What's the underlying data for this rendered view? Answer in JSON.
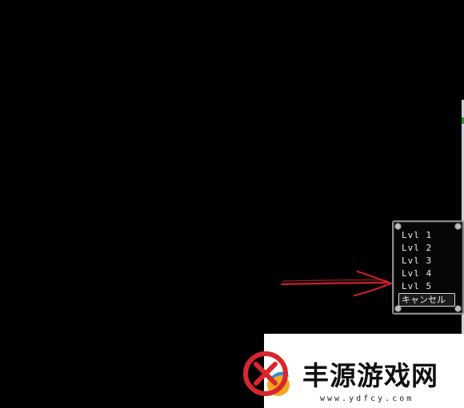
{
  "menu": {
    "items": [
      "Lvl 1",
      "Lvl 2",
      "Lvl 3",
      "Lvl 4",
      "Lvl 5"
    ],
    "cancel_label": "キャンセル"
  },
  "annotation": {
    "arrow_color": "#c8202a"
  },
  "watermark": {
    "title": "丰源游戏网",
    "url": "www.ydfcy.com",
    "logo_icon": "no-entry-logo-icon",
    "colors": {
      "red": "#d9262c",
      "yellow": "#f4a81f",
      "blue": "#2f8fd8"
    }
  }
}
